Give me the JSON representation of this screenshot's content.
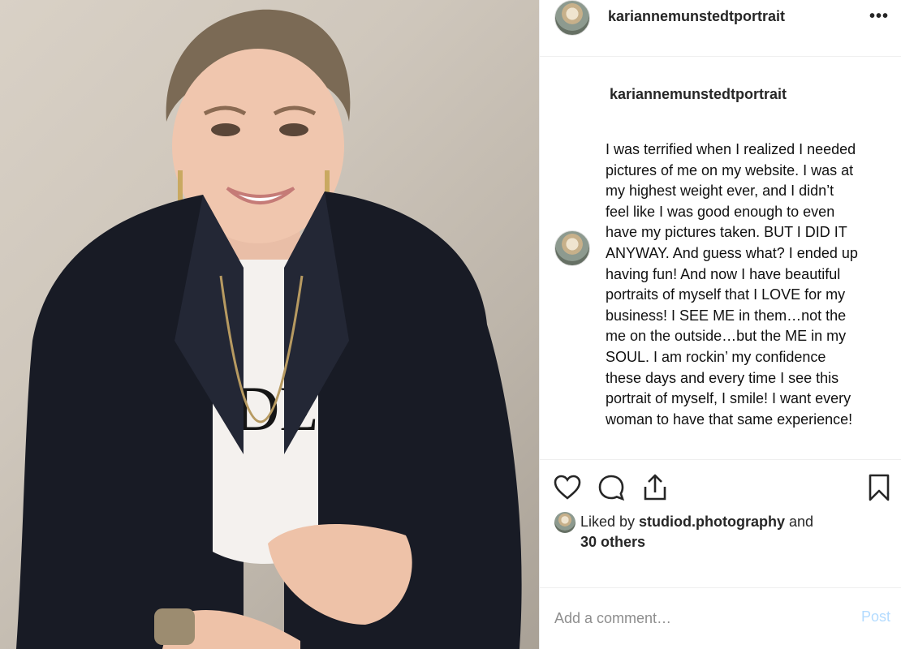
{
  "header": {
    "username": "kariannemunstedtportrait",
    "more_label": "•••"
  },
  "caption": {
    "username": "kariannemunstedtportrait",
    "text": "I was terrified when I realized I needed\npictures of me on my website. I was at\nmy highest weight ever, and I didn’t\nfeel like I was good enough to even\nhave my pictures taken. BUT I DID IT\nANYWAY. And guess what? I ended up\nhaving fun! And now I have beautiful\nportraits of myself that I LOVE for my\nbusiness! I SEE ME in them…not the\nme on the outside…but the ME in my\nSOUL. I am rockin’ my confidence\nthese days and every time I see this\nportrait of myself, I smile! I want every\nwoman to have  that same experience!"
  },
  "actions": {
    "like_icon": "heart-icon",
    "comment_icon": "comment-bubble-icon",
    "share_icon": "share-icon",
    "save_icon": "bookmark-icon"
  },
  "likes": {
    "prefix": "Liked by ",
    "user": "studiod.photography",
    "middle": " and",
    "others": "30 others"
  },
  "comment": {
    "placeholder": "Add a comment…",
    "post_label": "Post"
  },
  "photo": {
    "shirt_text": "DE"
  },
  "colors": {
    "post_button": "#b3dbff",
    "border": "#efefef",
    "text": "#262626"
  }
}
